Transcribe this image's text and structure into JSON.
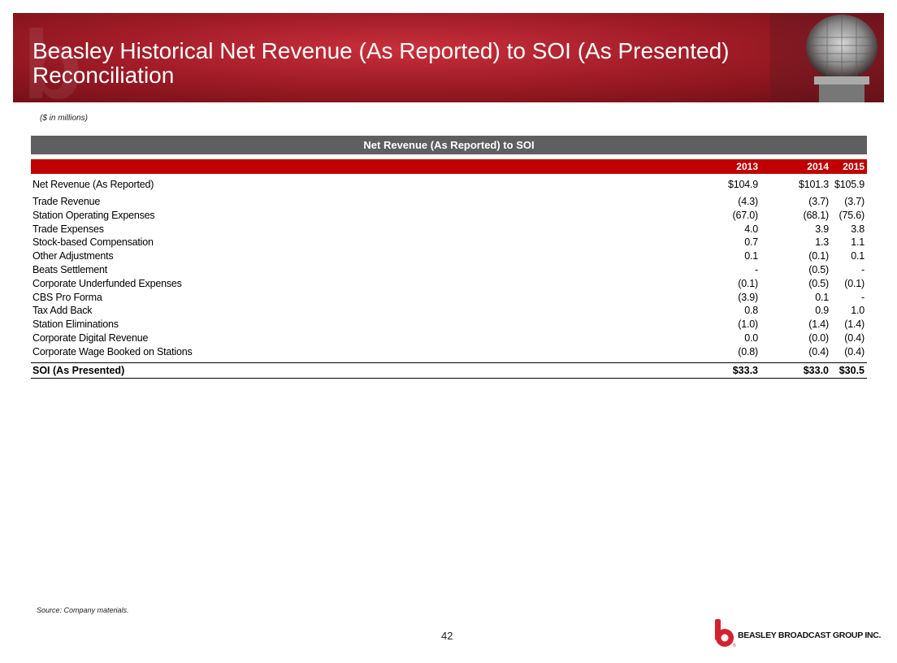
{
  "title": "Beasley Historical Net Revenue (As Reported) to SOI (As Presented) Reconciliation",
  "units_note": "($ in millions)",
  "table": {
    "header": "Net Revenue (As Reported) to SOI",
    "years": [
      "2013",
      "2014",
      "2015"
    ],
    "rows": [
      {
        "label": "Net Revenue (As Reported)",
        "values": [
          "$104.9",
          "$101.3",
          "$105.9"
        ]
      },
      {
        "label": "Trade Revenue",
        "values": [
          "(4.3)",
          "(3.7)",
          "(3.7)"
        ]
      },
      {
        "label": "Station Operating Expenses",
        "values": [
          "(67.0)",
          "(68.1)",
          "(75.6)"
        ]
      },
      {
        "label": "Trade Expenses",
        "values": [
          "4.0",
          "3.9",
          "3.8"
        ]
      },
      {
        "label": "Stock-based Compensation",
        "values": [
          "0.7",
          "1.3",
          "1.1"
        ]
      },
      {
        "label": "Other Adjustments",
        "values": [
          "0.1",
          "(0.1)",
          "0.1"
        ]
      },
      {
        "label": "Beats Settlement",
        "values": [
          "-",
          "(0.5)",
          "-"
        ]
      },
      {
        "label": "Corporate Underfunded Expenses",
        "values": [
          "(0.1)",
          "(0.5)",
          "(0.1)"
        ]
      },
      {
        "label": "CBS Pro Forma",
        "values": [
          "(3.9)",
          "0.1",
          "-"
        ]
      },
      {
        "label": "Tax Add Back",
        "values": [
          "0.8",
          "0.9",
          "1.0"
        ]
      },
      {
        "label": "Station Eliminations",
        "values": [
          "(1.0)",
          "(1.4)",
          "(1.4)"
        ]
      },
      {
        "label": "Corporate Digital Revenue",
        "values": [
          "0.0",
          "(0.0)",
          "(0.4)"
        ]
      },
      {
        "label": "Corporate Wage Booked on Stations",
        "values": [
          "(0.8)",
          "(0.4)",
          "(0.4)"
        ]
      }
    ],
    "total": {
      "label": "SOI (As Presented)",
      "values": [
        "$33.3",
        "$33.0",
        "$30.5"
      ]
    }
  },
  "source": "Source: Company materials.",
  "page_number": "42",
  "logo": {
    "text": "BEASLEY BROADCAST GROUP INC.",
    "icon": "beasley-b-logo-icon"
  },
  "colors": {
    "banner": "#a11c27",
    "header_bar": "#5f5f5f",
    "year_bar": "#c00000",
    "logo_red": "#d4202f"
  }
}
